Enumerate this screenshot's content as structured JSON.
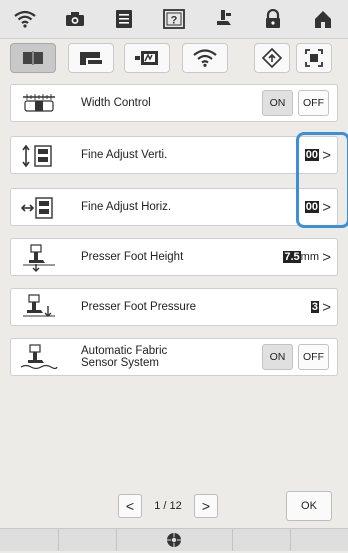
{
  "top_icons": [
    "wifi-icon",
    "camera-icon",
    "document-icon",
    "help-icon",
    "presser-foot-icon",
    "lock-icon",
    "home-icon"
  ],
  "categories": [
    "machine-settings-icon",
    "sewing-settings-icon",
    "embroidery-settings-icon",
    "wifi-icon"
  ],
  "rows": {
    "width_control": {
      "label": "Width Control",
      "on": "ON",
      "off": "OFF"
    },
    "fine_vert": {
      "label": "Fine Adjust Verti.",
      "value": "00"
    },
    "fine_horiz": {
      "label": "Fine Adjust Horiz.",
      "value": "00"
    },
    "presser_height": {
      "label": "Presser Foot Height",
      "value": "7.5",
      "unit": "mm"
    },
    "presser_pressure": {
      "label": "Presser Foot Pressure",
      "value": "3"
    },
    "auto_fabric": {
      "label_line1": "Automatic Fabric",
      "label_line2": "Sensor System",
      "on": "ON",
      "off": "OFF"
    }
  },
  "pager": {
    "text": "1 / 12"
  },
  "ok_label": "OK",
  "accent": "#3d8fd8"
}
